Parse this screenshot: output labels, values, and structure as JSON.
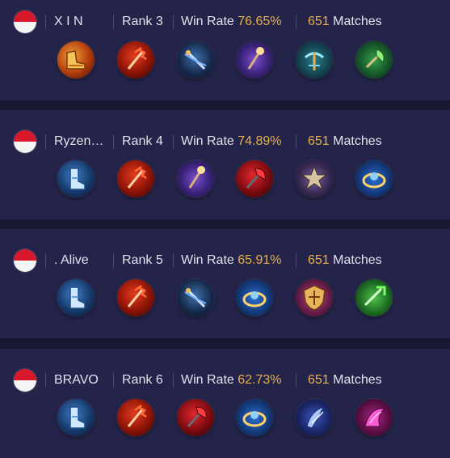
{
  "labels": {
    "rank_prefix": "Rank",
    "win_rate_label": "Win Rate",
    "matches_label": "Matches"
  },
  "players": [
    {
      "name": "X I N",
      "rank": "3",
      "win_rate": "76.65%",
      "matches": "651",
      "items": [
        "boots-gold-icon",
        "trident-icon",
        "spear-blue-icon",
        "staff-icon",
        "crossbow-icon",
        "axe-green-icon"
      ]
    },
    {
      "name": "Ryzen…",
      "rank": "4",
      "win_rate": "74.89%",
      "matches": "651",
      "items": [
        "boots-blue-icon",
        "trident-icon",
        "staff-icon",
        "axe-red-icon",
        "spiked-icon",
        "ring-icon"
      ]
    },
    {
      "name": ". Alive",
      "rank": "5",
      "win_rate": "65.91%",
      "matches": "651",
      "items": [
        "boots-blue-icon",
        "trident-icon",
        "spear-blue-icon",
        "ring-icon",
        "shield-gold-icon",
        "arrow-green-icon"
      ]
    },
    {
      "name": "BRAVO",
      "rank": "6",
      "win_rate": "62.73%",
      "matches": "651",
      "items": [
        "boots-blue-icon",
        "trident-icon",
        "axe-red-icon",
        "ring-icon",
        "blade-blue-icon",
        "wing-pink-icon"
      ]
    }
  ],
  "colors": {
    "page_bg": "#181833",
    "card_bg": "#24244a",
    "text": "#e2e2ee",
    "accent": "#e8b04a",
    "flag_red": "#d8192c",
    "flag_white": "#f5f5f5"
  }
}
